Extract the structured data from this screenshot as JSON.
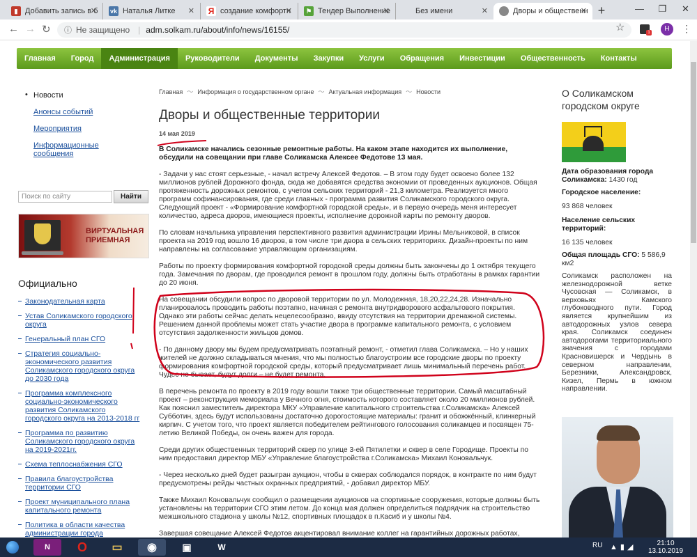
{
  "browser": {
    "tabs": [
      {
        "title": "Добавить запись в б",
        "color": "#c0392b",
        "glyph": "▮",
        "active": false
      },
      {
        "title": "Наталья Литке",
        "color": "#4a76a8",
        "glyph": "vk",
        "active": false
      },
      {
        "title": "создание комфортн",
        "color": "#ffffff",
        "glyph": "Я",
        "active": false
      },
      {
        "title": "Тендер Выполнение",
        "color": "#56a33a",
        "glyph": "⚑",
        "active": false
      },
      {
        "title": "Без имени",
        "color": "#dee1e6",
        "glyph": "",
        "active": false
      },
      {
        "title": "Дворы и общественн",
        "color": "#888888",
        "glyph": "◐",
        "active": true
      }
    ],
    "address": {
      "security": "Не защищено",
      "url": "adm.solkam.ru/about/info/news/16155/"
    },
    "profile_letter": "H"
  },
  "menu": [
    "Главная",
    "Город",
    "Администрация",
    "Руководители",
    "Документы",
    "Закупки",
    "Услуги",
    "Обращения",
    "Инвестиции",
    "Общественность",
    "Контакты"
  ],
  "menu_active": "Администрация",
  "leftnav": {
    "current": "Новости",
    "links": [
      "Анонсы событий",
      "Мероприятия",
      "Информационные сообщения"
    ]
  },
  "search": {
    "placeholder": "Поиск по сайту",
    "button": "Найти"
  },
  "banner": {
    "line1": "ВИРТУАЛЬНАЯ",
    "line2": "ПРИЕМНАЯ"
  },
  "official": {
    "heading": "Официально",
    "links": [
      "Законодательная карта",
      "Устав Соликамского городского округа",
      "Генеральный план СГО",
      "Стратегия социально-экономического развития Соликамского городского округа до 2030 года",
      "Программа комплексного социально-экономического развития Соликамского городского округа на 2013-2018 гг",
      "Программа по развитию Соликамского городского округа на 2019-2021гг.",
      "Схема теплоснабжения СГО",
      "Правила благоустройства территории СГО",
      "Проект муниципального плана капитального ремонта",
      "Политика в области качества администрации города Соликамска и ее отраслевых (функциональных)"
    ]
  },
  "breadcrumbs": [
    "Главная",
    "Информация о государственном органе",
    "Актуальная информация",
    "Новости"
  ],
  "article": {
    "title": "Дворы и общественные территории",
    "date": "14 мая 2019",
    "lead": "В Соликамске начались сезонные ремонтные работы. На каком этапе находится их выполнение, обсудили на совещании при главе Соликамска Алексее Федотове 13 мая.",
    "paragraphs": [
      "- Задачи у нас стоят серьезные, - начал встречу Алексей Федотов. – В этом году будет освоено более 132 миллионов рублей Дорожного фонда, сюда же добавятся средства экономии от проведенных аукционов. Общая протяженность дорожных ремонтов, с учетом сельских территорий - 21,3 километра. Реализуется много программ софинансирования, где среди главных - программа развития Соликамского городского округа. Следующий проект - «Формирование комфортной городской среды», и в первую очередь меня интересует количество, адреса дворов, имеющиеся проекты, исполнение дорожной карты по ремонту дворов.",
      "По словам начальника управления перспективного развития администрации Ирины Мельниковой, в список проекта на 2019 год вошло 16 дворов, в том числе три двора в сельских территориях. Дизайн-проекты по ним направлены на согласование управляющим организациям.",
      "Работы по проекту формирования комфортной городской среды должны быть закончены до 1 октября текущего года. Замечания по дворам, где проводился ремонт в прошлом году, должны быть отработаны в рамках гарантии до 20 июня.",
      "На совещании обсудили вопрос по дворовой территории по ул. Молодежная, 18,20,22,24,28. Изначально планировалось проводить работы поэтапно, начиная с ремонта внутридворового асфальтового покрытия. Однако эти работы сейчас делать нецелесообразно, ввиду отсутствия на территории дренажной системы. Решением данной проблемы может стать участие двора в программе капитального ремонта, с условием отсутствия задолженности жильцов домов.",
      "- По данному двору мы будем предусматривать поэтапный ремонт, - отметил глава Соликамска. – Но у наших жителей не должно складываться мнения, что мы полностью благоустроим все городские дворы по проекту формирования комфортной городской среды, который предусматривает лишь минимальный перечень работ. Чудес не бывает, будут долги – не будет ремонта.",
      "В перечень ремонта по проекту в 2019 году вошли также три общественные территории. Самый масштабный проект – реконструкция мемориала у Вечного огня, стоимость которого составляет около 20 миллионов рублей. Как пояснил заместитель директора МКУ «Управление капитального строительства г.Соликамска» Алексей Субботин, здесь будут использованы достаточно дорогостоящие материалы: гранит и обожжённый, клинкерный кирпич. С учетом того, что проект является победителем рейтингового голосования соликамцев и посвящен 75-летию Великой Победы, он очень важен для города.",
      "Среди других общественных территорий сквер по улице 3-ей Пятилетки и сквер в селе Городище. Проекты по ним предоставил директор МБУ «Управление благоустройства г.Соликамска» Михаил Коновальчук.",
      "- Через несколько дней будет разыгран аукцион, чтобы в скверах соблюдался порядок, в контракте по ним будут предусмотрены рейды частных охранных предприятий, - добавил директор МБУ.",
      "Также Михаил Коновальчук сообщил о размещении аукционов на спортивные сооружения, которые должны быть установлены на территории СГО этим летом. До конца мая должен определиться подрядчик на строительство межшкольного стадиона у школы №12, спортивных площадок в п.Касиб и у школы №4.",
      "Завершая совещание Алексей Федотов акцентировал внимание коллег на гарантийных дорожных работах, оперативном проведении дорожной разметки."
    ]
  },
  "right": {
    "title": "О Соликамском городском округе",
    "founded_label": "Дата образования города Соликамска:",
    "founded_value": "1430 год",
    "pop_label": "Городское население:",
    "pop_value": "93 868 человек",
    "rural_label": "Население сельских территорий:",
    "rural_value": "16 135 человек",
    "area_label": "Общая площадь СГО:",
    "area_value": "5 586,9 км2",
    "description": "Соликамск расположен на железнодорожной ветке Чусовская — Соликамск, в верховьях Камского глубоководного пути. Город является крупнейшим из автодорожных узлов севера края. Соликамск соединен автодорогами территориального значения с городами Красновишерск и Чердынь в северном направлении, Березники, Александровск, Кизел, Пермь в южном направлении."
  },
  "taskbar": {
    "lang": "RU",
    "time": "21:10",
    "date": "13.10.2019"
  },
  "colors": {
    "menu_green": "#6aab28",
    "link": "#1a4f9c",
    "annotation_red": "#d0021b"
  }
}
